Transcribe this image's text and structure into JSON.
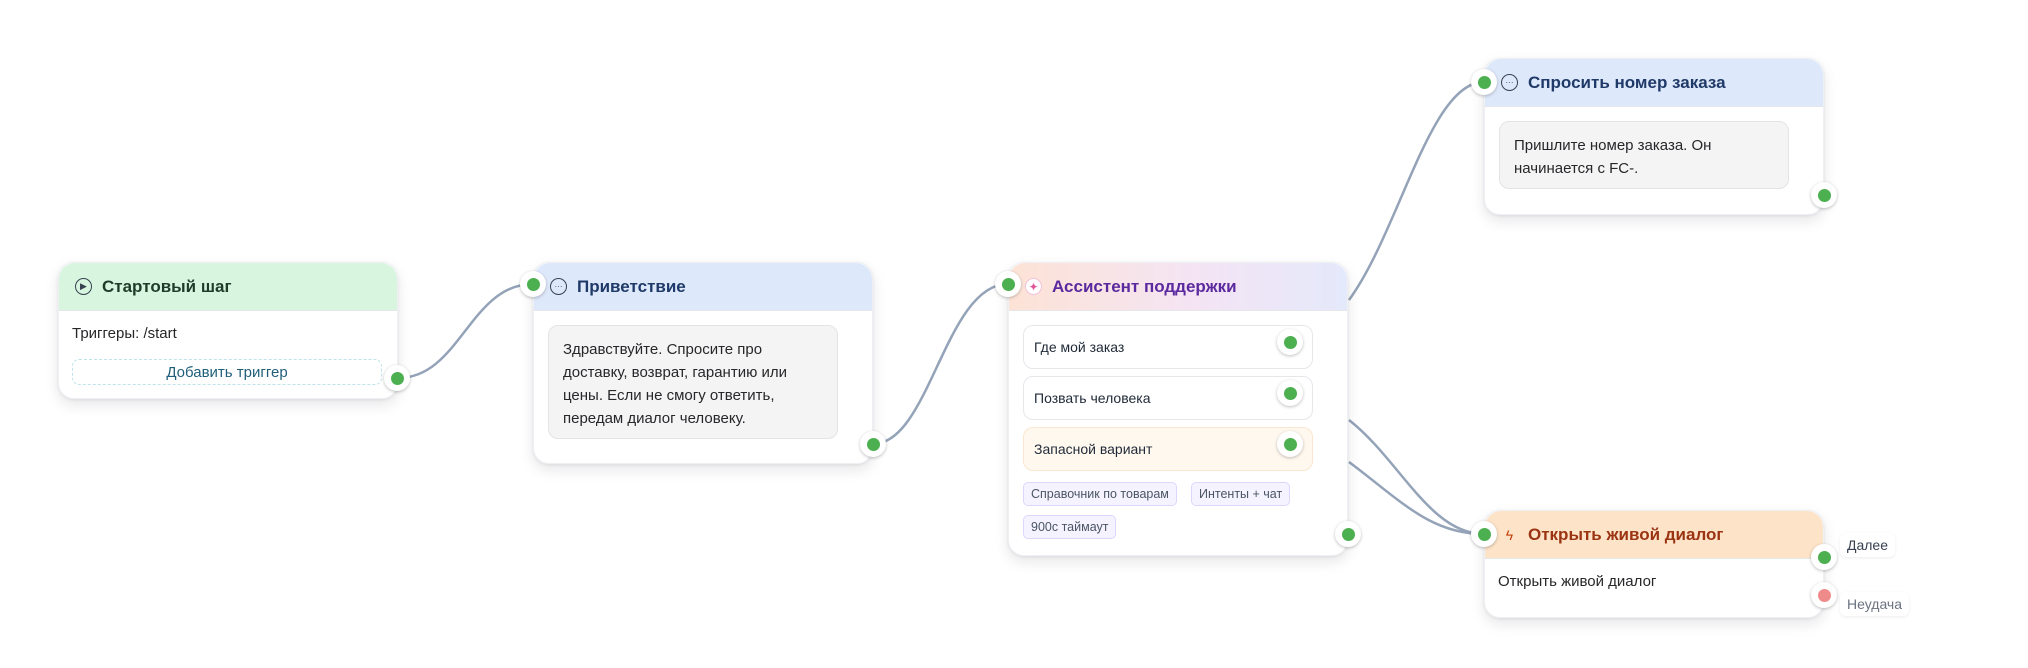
{
  "colors": {
    "edge": "#94a3b8",
    "port_ok": "#4caf50",
    "port_fail": "#ef8a8a"
  },
  "nodes": {
    "start": {
      "title": "Стартовый шаг",
      "icon": "play-circle-icon",
      "triggers_text": "Триггеры: /start",
      "add_trigger_label": "Добавить триггер"
    },
    "greeting": {
      "title": "Приветствие",
      "icon": "chat-bubble-icon",
      "message": "Здравствуйте. Спросите про доставку, возврат, гарантию или цены. Если не смогу ответить, передам диалог человеку."
    },
    "assistant": {
      "title": "Ассистент поддержки",
      "icon": "sparkle-icon",
      "intents": [
        {
          "label": "Где мой заказ"
        },
        {
          "label": "Позвать человека"
        },
        {
          "label": "Запасной вариант"
        }
      ],
      "tags": [
        "Справочник по товарам",
        "Интенты + чат",
        "900с таймаут"
      ]
    },
    "ask_order": {
      "title": "Спросить номер заказа",
      "icon": "chat-bubble-icon",
      "message": "Пришлите номер заказа. Он начинается с FC-."
    },
    "live_chat": {
      "title": "Открыть живой диалог",
      "icon": "bolt-icon",
      "body_text": "Открыть живой диалог",
      "outputs": {
        "next_label": "Далее",
        "fail_label": "Неудача"
      }
    }
  }
}
